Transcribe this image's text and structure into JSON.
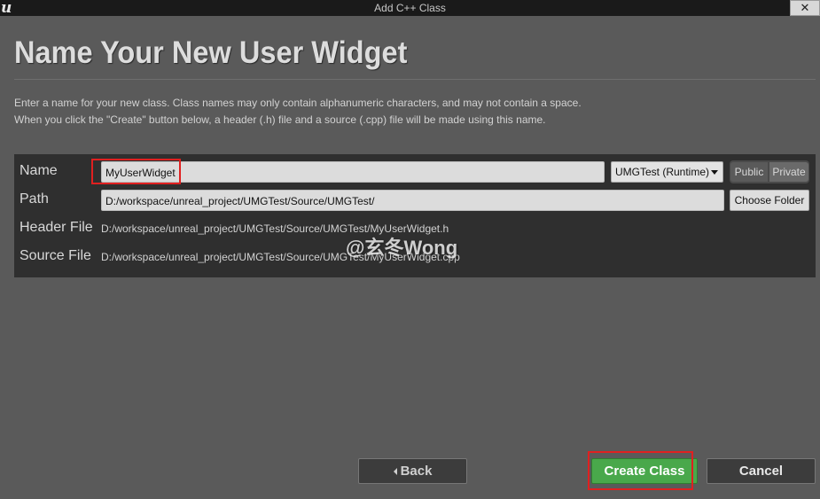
{
  "window": {
    "title": "Add C++ Class",
    "logo_letter": "u",
    "close_glyph": "✕"
  },
  "header": {
    "title": "Name Your New User Widget",
    "description_line1": "Enter a name for your new class. Class names may only contain alphanumeric characters, and may not contain a space.",
    "description_line2": "When you click the \"Create\" button below, a header (.h) file and a source (.cpp) file will be made using this name."
  },
  "form": {
    "name_label": "Name",
    "name_value": "MyUserWidget",
    "module_value": "UMGTest (Runtime)",
    "public_label": "Public",
    "private_label": "Private",
    "path_label": "Path",
    "path_value": "D:/workspace/unreal_project/UMGTest/Source/UMGTest/",
    "choose_folder_label": "Choose Folder",
    "header_file_label": "Header File",
    "header_file_value": "D:/workspace/unreal_project/UMGTest/Source/UMGTest/MyUserWidget.h",
    "source_file_label": "Source File",
    "source_file_value": "D:/workspace/unreal_project/UMGTest/Source/UMGTest/MyUserWidget.cpp"
  },
  "watermark": "@玄冬Wong",
  "footer": {
    "back_label": "Back",
    "create_label": "Create Class",
    "cancel_label": "Cancel"
  },
  "colors": {
    "background": "#5a5a5a",
    "panel": "#2f2f2f",
    "create_button": "#49a84b",
    "highlight": "#e02020"
  },
  "icons": {
    "logo": "unreal-logo-icon",
    "close": "close-icon",
    "dropdown": "chevron-down-icon",
    "back": "chevron-left-icon"
  }
}
